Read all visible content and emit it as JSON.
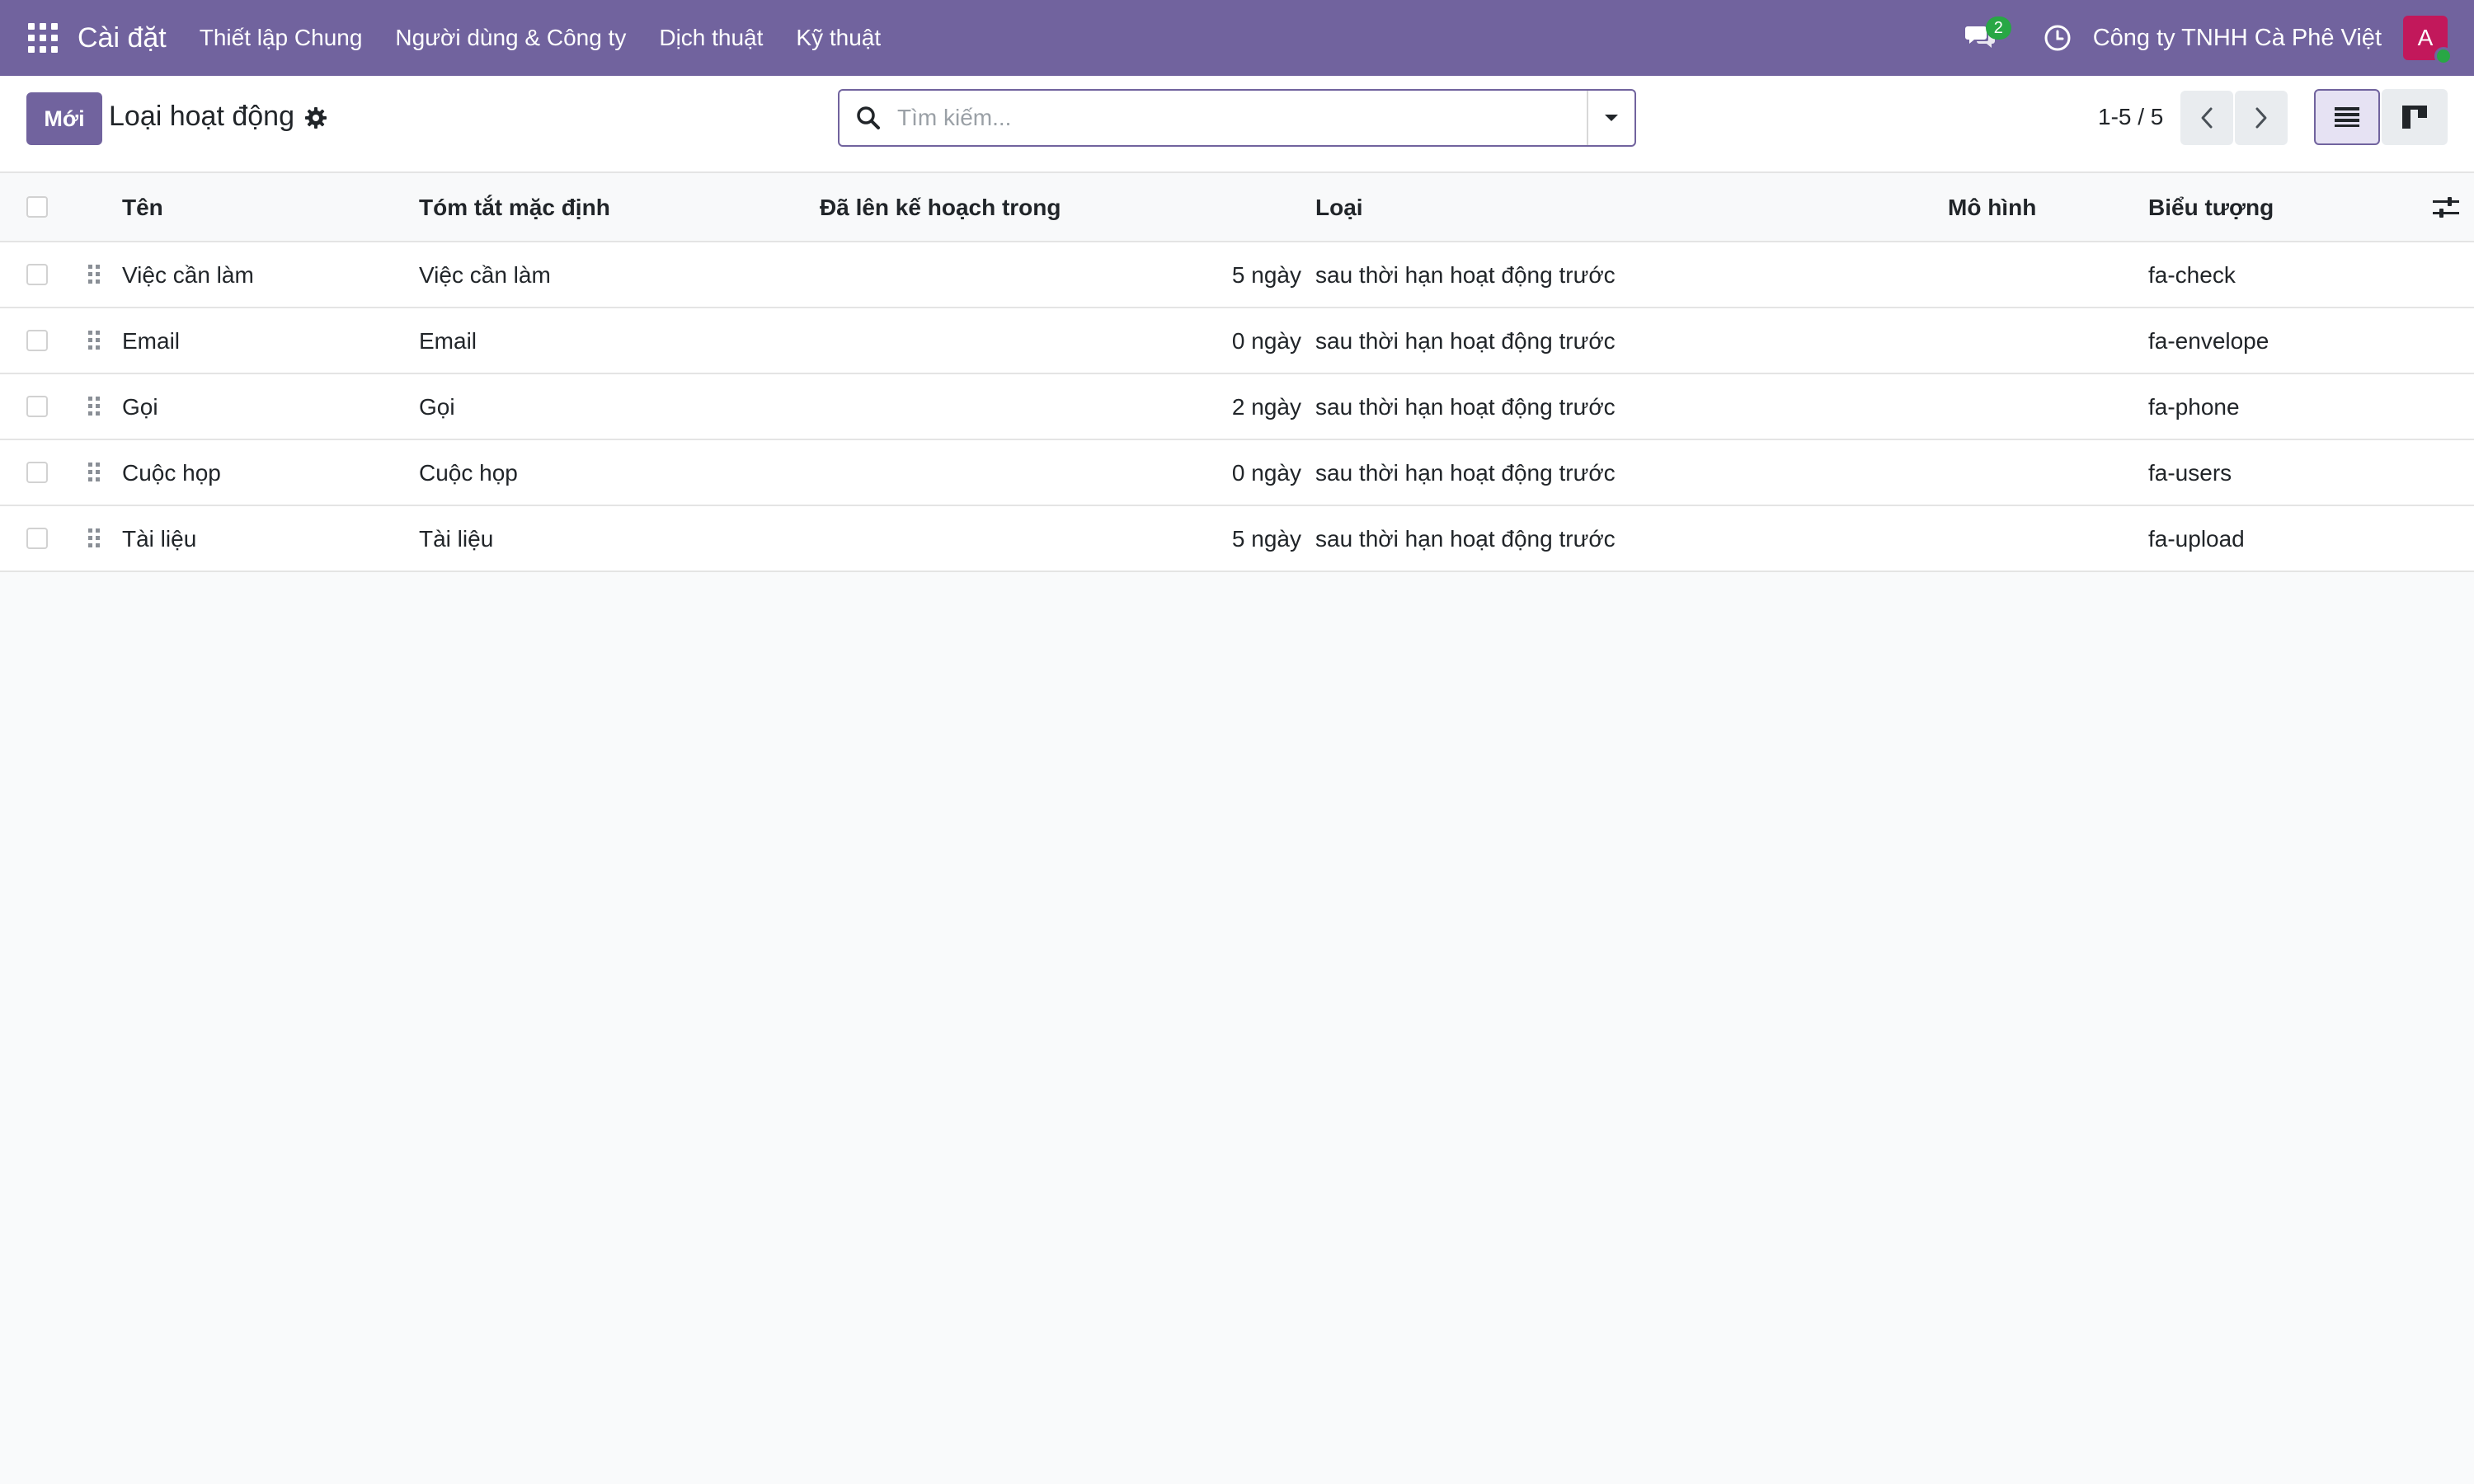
{
  "topbar": {
    "app_name": "Cài đặt",
    "menu": [
      "Thiết lập Chung",
      "Người dùng & Công ty",
      "Dịch thuật",
      "Kỹ thuật"
    ],
    "chat_count": "2",
    "company": "Công ty TNHH Cà Phê Việt",
    "avatar_letter": "A",
    "icons": {
      "apps": "apps-grid-icon",
      "chat": "chat-icon",
      "activity": "clock-icon"
    },
    "colors": {
      "bar": "#71639e",
      "badge": "#28a745",
      "avatar": "#c2185b"
    }
  },
  "control": {
    "new_label": "Mới",
    "title": "Loại hoạt động",
    "search_placeholder": "Tìm kiếm...",
    "pager": "1-5 / 5"
  },
  "table": {
    "columns": [
      "Tên",
      "Tóm tắt mặc định",
      "Đã lên kế hoạch trong",
      "Loại",
      "Mô hình",
      "Biểu tượng"
    ],
    "rows": [
      {
        "name": "Việc cần làm",
        "summary": "Việc cần làm",
        "planned": "5 ngày",
        "type": "sau thời hạn hoạt động trước",
        "model": "",
        "icon": "fa-check"
      },
      {
        "name": "Email",
        "summary": "Email",
        "planned": "0 ngày",
        "type": "sau thời hạn hoạt động trước",
        "model": "",
        "icon": "fa-envelope"
      },
      {
        "name": "Gọi",
        "summary": "Gọi",
        "planned": "2 ngày",
        "type": "sau thời hạn hoạt động trước",
        "model": "",
        "icon": "fa-phone"
      },
      {
        "name": "Cuộc họp",
        "summary": "Cuộc họp",
        "planned": "0 ngày",
        "type": "sau thời hạn hoạt động trước",
        "model": "",
        "icon": "fa-users"
      },
      {
        "name": "Tài liệu",
        "summary": "Tài liệu",
        "planned": "5 ngày",
        "type": "sau thời hạn hoạt động trước",
        "model": "",
        "icon": "fa-upload"
      }
    ]
  }
}
